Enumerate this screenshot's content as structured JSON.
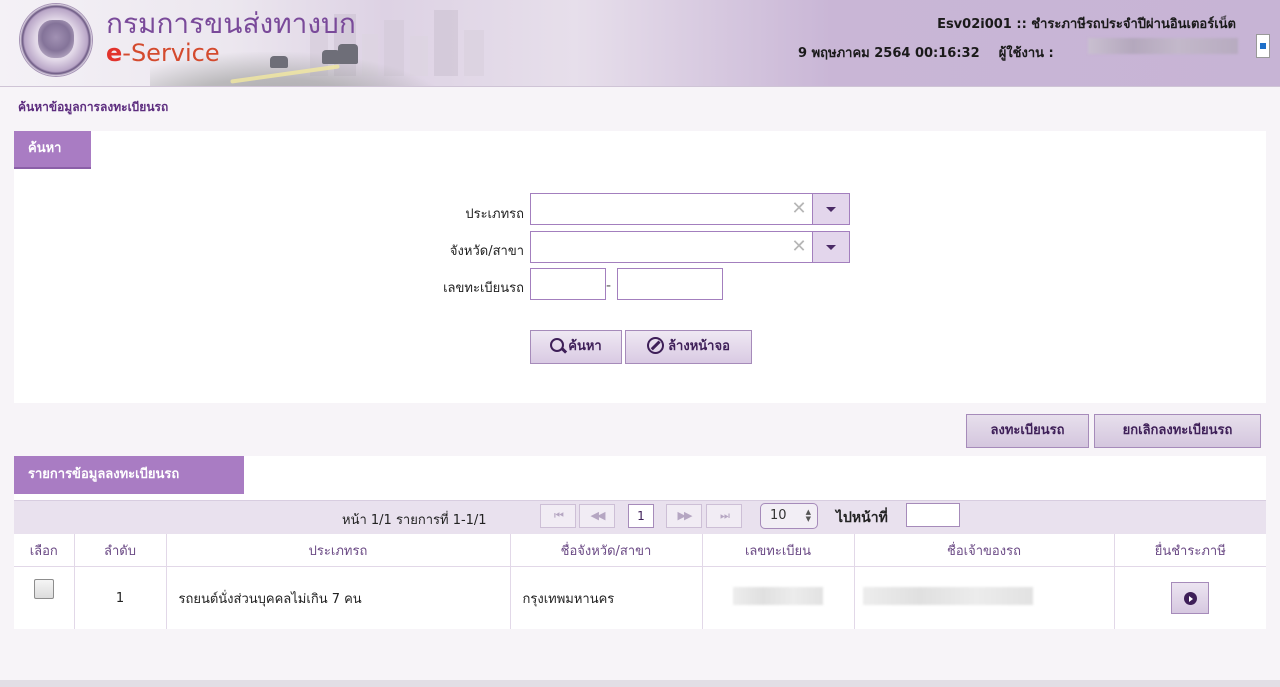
{
  "header": {
    "brand_th": "กรมการขนส่งทางบก",
    "brand_e": "e",
    "brand_service": "-Service",
    "screen_code_title": "Esv02i001 :: ชำระภาษีรถประจำปีผ่านอินเตอร์เน็ต",
    "datetime": "9 พฤษภาคม 2564 00:16:32",
    "user_label": "ผู้ใช้งาน :"
  },
  "page_title": "ค้นหาข้อมูลการลงทะเบียนรถ",
  "search": {
    "tab_label": "ค้นหา",
    "vehicle_type_label": "ประเภทรถ",
    "vehicle_type_value": "",
    "province_label": "จังหวัด/สาขา",
    "province_value": "",
    "plate_label": "เลขทะเบียนรถ",
    "plate_part1": "",
    "plate_part2": "",
    "plate_separator": "-",
    "clear_icon_glyph": "✕",
    "search_button": "ค้นหา",
    "reset_button": "ล้างหน้าจอ"
  },
  "actions": {
    "register_button": "ลงทะเบียนรถ",
    "unregister_button": "ยกเลิกลงทะเบียนรถ"
  },
  "list": {
    "tab_label": "รายการข้อมูลลงทะเบียนรถ",
    "pager": {
      "info": "หน้า 1/1 รายการที่ 1-1/1",
      "first": "⏮",
      "prev": "◀◀",
      "current_page": "1",
      "next": "▶▶",
      "last": "⏭",
      "page_size": "10",
      "goto_label": "ไปหน้าที่"
    },
    "columns": [
      "เลือก",
      "ลำดับ",
      "ประเภทรถ",
      "ชื่อจังหวัด/สาขา",
      "เลขทะเบียน",
      "ชื่อเจ้าของรถ",
      "ยื่นชำระภาษี"
    ],
    "rows": [
      {
        "seq": "1",
        "vehicle_type": "รถยนต์นั่งส่วนบุคคลไม่เกิน 7 คน",
        "province": "กรุงเทพมหานคร"
      }
    ]
  },
  "icons": {
    "search": "search-icon",
    "reset": "ban-icon",
    "pay": "play-circle-icon",
    "dropdown": "chevron-down-icon"
  },
  "colors": {
    "accent": "#a97cc3",
    "title": "#5d2d7f",
    "button_text": "#3e1f58"
  }
}
